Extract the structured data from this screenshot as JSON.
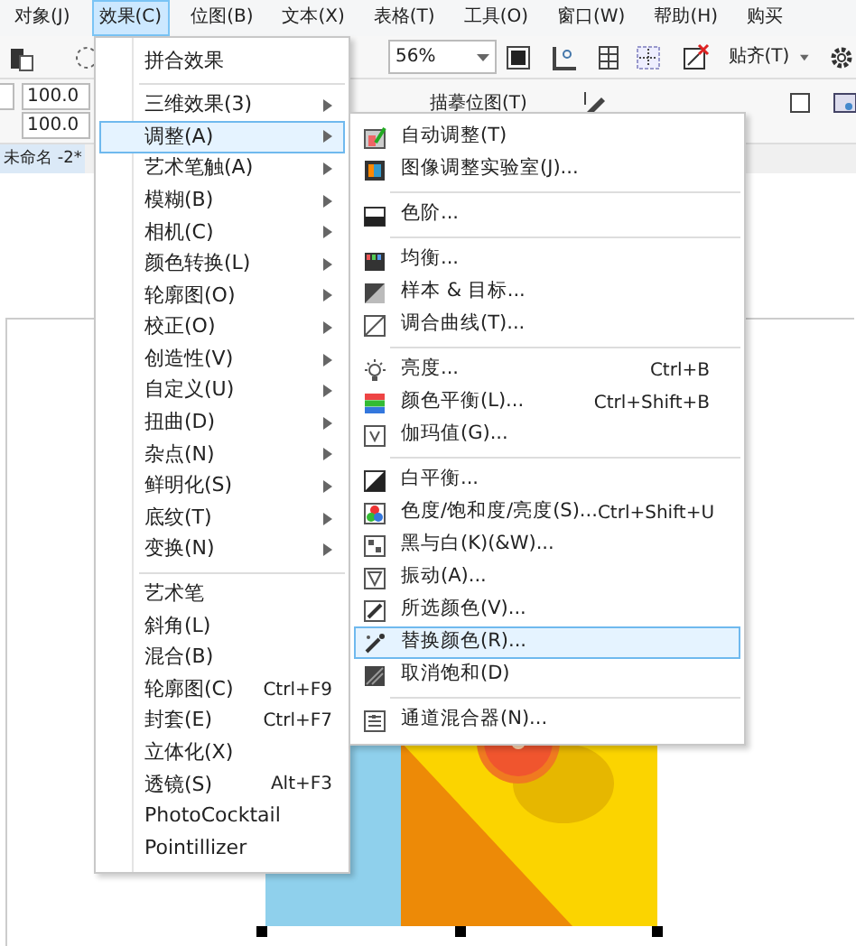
{
  "menubar": [
    {
      "label": "对象(J)",
      "selected": false
    },
    {
      "label": "效果(C)",
      "selected": true
    },
    {
      "label": "位图(B)",
      "selected": false
    },
    {
      "label": "文本(X)",
      "selected": false
    },
    {
      "label": "表格(T)",
      "selected": false
    },
    {
      "label": "工具(O)",
      "selected": false
    },
    {
      "label": "窗口(W)",
      "selected": false
    },
    {
      "label": "帮助(H)",
      "selected": false
    },
    {
      "label": "购买",
      "selected": false
    }
  ],
  "toolbar": {
    "zoom": "56%",
    "snap": "贴齐(T)",
    "trace": "描摹位图(T)",
    "fields": [
      "100.0",
      "100.0"
    ]
  },
  "document_tab": "未命名 -2*",
  "effects_menu": {
    "sections": [
      [
        {
          "label": "拼合效果",
          "submenu": false,
          "selected": false
        }
      ],
      [
        {
          "label": "三维效果(3)",
          "submenu": true,
          "selected": false
        },
        {
          "label": "调整(A)",
          "submenu": true,
          "selected": true
        },
        {
          "label": "艺术笔触(A)",
          "submenu": true,
          "selected": false
        },
        {
          "label": "模糊(B)",
          "submenu": true,
          "selected": false
        },
        {
          "label": "相机(C)",
          "submenu": true,
          "selected": false
        },
        {
          "label": "颜色转换(L)",
          "submenu": true,
          "selected": false
        },
        {
          "label": "轮廓图(O)",
          "submenu": true,
          "selected": false
        },
        {
          "label": "校正(O)",
          "submenu": true,
          "selected": false
        },
        {
          "label": "创造性(V)",
          "submenu": true,
          "selected": false
        },
        {
          "label": "自定义(U)",
          "submenu": true,
          "selected": false
        },
        {
          "label": "扭曲(D)",
          "submenu": true,
          "selected": false
        },
        {
          "label": "杂点(N)",
          "submenu": true,
          "selected": false
        },
        {
          "label": "鲜明化(S)",
          "submenu": true,
          "selected": false
        },
        {
          "label": "底纹(T)",
          "submenu": true,
          "selected": false
        },
        {
          "label": "变换(N)",
          "submenu": true,
          "selected": false
        }
      ],
      [
        {
          "label": "艺术笔",
          "submenu": false,
          "selected": false
        },
        {
          "label": "斜角(L)",
          "submenu": false,
          "selected": false
        },
        {
          "label": "混合(B)",
          "submenu": false,
          "selected": false
        },
        {
          "label": "轮廓图(C)",
          "shortcut": "Ctrl+F9",
          "submenu": false,
          "selected": false
        },
        {
          "label": "封套(E)",
          "shortcut": "Ctrl+F7",
          "submenu": false,
          "selected": false
        },
        {
          "label": "立体化(X)",
          "submenu": false,
          "selected": false
        },
        {
          "label": "透镜(S)",
          "shortcut": "Alt+F3",
          "submenu": false,
          "selected": false
        },
        {
          "label": "PhotoCocktail",
          "submenu": false,
          "selected": false
        },
        {
          "label": "Pointillizer",
          "submenu": false,
          "selected": false
        }
      ]
    ]
  },
  "adjust_menu": {
    "sections": [
      [
        {
          "label": "自动调整(T)",
          "selected": false
        },
        {
          "label": "图像调整实验室(J)...",
          "selected": false
        }
      ],
      [
        {
          "label": "色阶...",
          "selected": false
        }
      ],
      [
        {
          "label": "均衡...",
          "selected": false
        },
        {
          "label": "样本 & 目标...",
          "selected": false
        },
        {
          "label": "调合曲线(T)...",
          "selected": false
        }
      ],
      [
        {
          "label": "亮度...",
          "shortcut": "Ctrl+B",
          "selected": false
        },
        {
          "label": "颜色平衡(L)...",
          "shortcut": "Ctrl+Shift+B",
          "selected": false
        },
        {
          "label": "伽玛值(G)...",
          "selected": false
        }
      ],
      [
        {
          "label": "白平衡...",
          "selected": false
        },
        {
          "label": "色度/饱和度/亮度(S)...",
          "shortcut": "Ctrl+Shift+U",
          "selected": false
        },
        {
          "label": "黑与白(K)(&W)...",
          "selected": false
        },
        {
          "label": "振动(A)...",
          "selected": false
        },
        {
          "label": "所选颜色(V)...",
          "selected": false
        },
        {
          "label": "替换颜色(R)...",
          "selected": true
        },
        {
          "label": "取消饱和(D)",
          "selected": false
        }
      ],
      [
        {
          "label": "通道混合器(N)...",
          "selected": false
        }
      ]
    ]
  }
}
